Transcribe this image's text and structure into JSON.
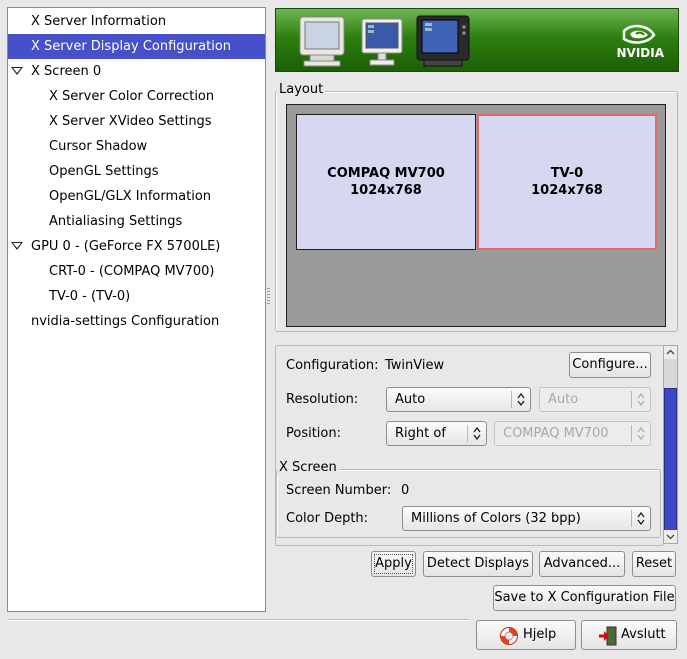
{
  "tree": {
    "items": [
      {
        "label": "X Server Information",
        "selected": false
      },
      {
        "label": "X Server Display Configuration",
        "selected": true
      },
      {
        "label": "X Screen 0",
        "expanded": true
      },
      {
        "label": "X Server Color Correction"
      },
      {
        "label": "X Server XVideo Settings"
      },
      {
        "label": "Cursor Shadow"
      },
      {
        "label": "OpenGL Settings"
      },
      {
        "label": "OpenGL/GLX Information"
      },
      {
        "label": "Antialiasing Settings"
      },
      {
        "label": "GPU 0 - (GeForce FX 5700LE)",
        "expanded": true
      },
      {
        "label": "CRT-0 - (COMPAQ MV700)"
      },
      {
        "label": "TV-0 - (TV-0)"
      },
      {
        "label": "nvidia-settings Configuration"
      }
    ]
  },
  "banner": {
    "brand": "NVIDIA",
    "accent": "#76b900"
  },
  "layout": {
    "title": "Layout",
    "displays": [
      {
        "name": "COMPAQ MV700",
        "resolution": "1024x768",
        "selected": false
      },
      {
        "name": "TV-0",
        "resolution": "1024x768",
        "selected": true
      }
    ]
  },
  "display_settings": {
    "configuration_label": "Configuration:",
    "configuration_value": "TwinView",
    "configure_button": "Configure...",
    "resolution_label": "Resolution:",
    "resolution_value": "Auto",
    "refresh_value": "Auto",
    "position_label": "Position:",
    "position_value": "Right of",
    "position_relative": "COMPAQ MV700"
  },
  "x_screen": {
    "title": "X Screen",
    "screen_number_label": "Screen Number:",
    "screen_number_value": "0",
    "color_depth_label": "Color Depth:",
    "color_depth_value": "Millions of Colors (32 bpp)"
  },
  "actions": {
    "apply": "Apply",
    "detect": "Detect Displays",
    "advanced": "Advanced...",
    "reset": "Reset",
    "save": "Save to X Configuration File"
  },
  "footer": {
    "help": "Hjelp",
    "quit": "Avslutt"
  },
  "colors": {
    "selection": "#4650c8",
    "display_fill": "#d7d7f1",
    "display_selected_border": "#e06a6a"
  }
}
